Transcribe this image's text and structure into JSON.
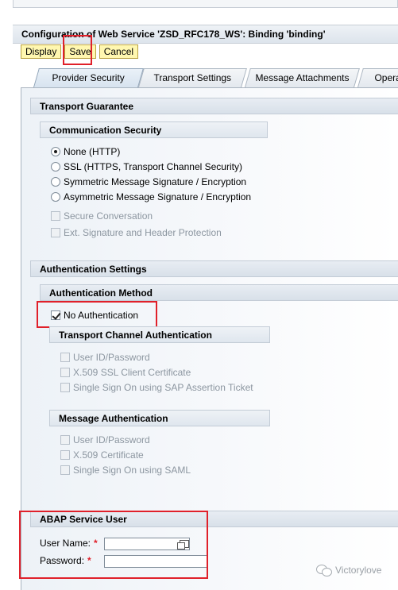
{
  "window": {
    "title": "Configuration of Web Service 'ZSD_RFC178_WS': Binding 'binding'"
  },
  "toolbar": {
    "display_label": "Display",
    "save_label": "Save",
    "cancel_label": "Cancel"
  },
  "tabs": [
    {
      "label": "Provider Security",
      "active": true
    },
    {
      "label": "Transport Settings",
      "active": false
    },
    {
      "label": "Message Attachments",
      "active": false
    },
    {
      "label": "Opera",
      "active": false
    }
  ],
  "transport_guarantee": {
    "title": "Transport Guarantee",
    "communication_security": {
      "title": "Communication Security",
      "options": [
        {
          "label": "None (HTTP)",
          "selected": true
        },
        {
          "label": "SSL (HTTPS, Transport Channel Security)",
          "selected": false
        },
        {
          "label": "Symmetric Message Signature / Encryption",
          "selected": false
        },
        {
          "label": "Asymmetric Message Signature / Encryption",
          "selected": false
        }
      ],
      "checkboxes": [
        {
          "label": "Secure Conversation",
          "checked": false,
          "disabled": true
        },
        {
          "label": "Ext. Signature and Header Protection",
          "checked": false,
          "disabled": true
        }
      ]
    }
  },
  "authentication_settings": {
    "title": "Authentication Settings",
    "method": {
      "title": "Authentication Method",
      "no_auth_label": "No Authentication",
      "no_auth_checked": true
    },
    "transport_channel": {
      "title": "Transport Channel Authentication",
      "options": [
        {
          "label": "User ID/Password"
        },
        {
          "label": "X.509 SSL Client Certificate"
        },
        {
          "label": "Single Sign On using SAP Assertion Ticket"
        }
      ]
    },
    "message_auth": {
      "title": "Message Authentication",
      "options": [
        {
          "label": "User ID/Password"
        },
        {
          "label": "X.509 Certificate"
        },
        {
          "label": "Single Sign On using SAML"
        }
      ]
    }
  },
  "abap_service_user": {
    "title": "ABAP Service User",
    "user_name_label": "User Name:",
    "password_label": "Password:",
    "required_mark": "*",
    "user_name_value": "",
    "password_value": ""
  },
  "watermark": {
    "text": "Victorylove"
  },
  "colors": {
    "highlight": "#e0202a",
    "button_bg": "#fff7b0"
  }
}
